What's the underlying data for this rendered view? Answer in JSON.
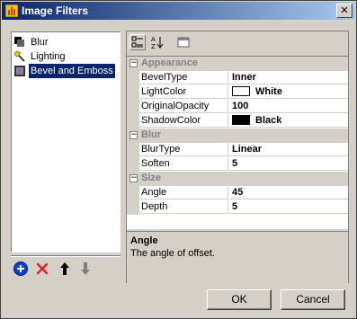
{
  "window": {
    "title": "Image Filters",
    "close_label": "✕"
  },
  "filters": {
    "items": [
      {
        "label": "Blur",
        "icon": "blur-filter-icon",
        "selected": false
      },
      {
        "label": "Lighting",
        "icon": "lighting-filter-icon",
        "selected": false
      },
      {
        "label": "Bevel and Emboss",
        "icon": "bevel-filter-icon",
        "selected": true
      }
    ]
  },
  "list_toolbar": [
    "add-icon",
    "delete-icon",
    "move-up-icon",
    "move-down-icon"
  ],
  "property_grid": {
    "toolbar": [
      "categorized-icon",
      "alphabetical-icon",
      "property-pages-icon"
    ],
    "categories": [
      {
        "name": "Appearance",
        "properties": [
          {
            "name": "BevelType",
            "value": "Inner"
          },
          {
            "name": "LightColor",
            "value": "White",
            "swatch": "#ffffff"
          },
          {
            "name": "OriginalOpacity",
            "value": "100"
          },
          {
            "name": "ShadowColor",
            "value": "Black",
            "swatch": "#000000"
          }
        ]
      },
      {
        "name": "Blur",
        "properties": [
          {
            "name": "BlurType",
            "value": "Linear"
          },
          {
            "name": "Soften",
            "value": "5"
          }
        ]
      },
      {
        "name": "Size",
        "properties": [
          {
            "name": "Angle",
            "value": "45"
          },
          {
            "name": "Depth",
            "value": "5"
          }
        ]
      }
    ],
    "description": {
      "title": "Angle",
      "text": "The angle of offset."
    }
  },
  "buttons": {
    "ok": "OK",
    "cancel": "Cancel"
  },
  "colors": {
    "title_start": "#0a246a",
    "title_end": "#a6caf0",
    "selection": "#0a246a",
    "face": "#d4d0c8"
  }
}
